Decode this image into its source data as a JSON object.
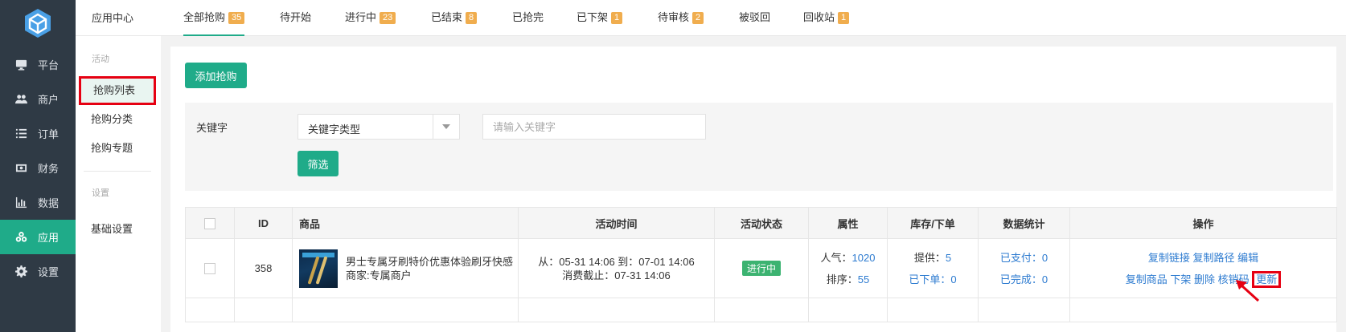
{
  "sidebar": {
    "items": [
      {
        "label": "平台",
        "icon": "monitor-icon"
      },
      {
        "label": "商户",
        "icon": "users-icon"
      },
      {
        "label": "订单",
        "icon": "list-icon"
      },
      {
        "label": "财务",
        "icon": "money-icon"
      },
      {
        "label": "数据",
        "icon": "bar-chart-icon"
      },
      {
        "label": "应用",
        "icon": "apps-icon"
      },
      {
        "label": "设置",
        "icon": "gear-icon"
      }
    ],
    "active": "应用"
  },
  "subnav": {
    "title": "应用中心",
    "group1": "活动",
    "items1": [
      "抢购列表",
      "抢购分类",
      "抢购专题"
    ],
    "group2": "设置",
    "items2": [
      "基础设置"
    ]
  },
  "tabs": [
    {
      "label": "全部抢购",
      "badge": "35"
    },
    {
      "label": "待开始",
      "badge": ""
    },
    {
      "label": "进行中",
      "badge": "23"
    },
    {
      "label": "已结束",
      "badge": "8"
    },
    {
      "label": "已抢完",
      "badge": ""
    },
    {
      "label": "已下架",
      "badge": "1"
    },
    {
      "label": "待审核",
      "badge": "2"
    },
    {
      "label": "被驳回",
      "badge": ""
    },
    {
      "label": "回收站",
      "badge": "1"
    }
  ],
  "toolbar": {
    "add_label": "添加抢购"
  },
  "filter": {
    "keyword_label": "关键字",
    "select_value": "关键字类型",
    "input_placeholder": "请输入关键字",
    "submit_label": "筛选"
  },
  "table": {
    "headers": [
      "ID",
      "商品",
      "活动时间",
      "活动状态",
      "属性",
      "库存/下单",
      "数据统计",
      "操作"
    ],
    "row": {
      "id": "358",
      "product_line1": "男士专属牙刷特价优惠体验刷牙快感",
      "product_line2": "商家:专属商户",
      "time_line1": "从：05-31 14:06 到：07-01 14:06",
      "time_line2": "消费截止：07-31 14:06",
      "status": "进行中",
      "popularity_label": "人气：",
      "popularity_value": "1020",
      "sort_label": "排序：",
      "sort_value": "55",
      "supply_label": "提供：",
      "supply_value": "5",
      "ordered_label": "已下单：",
      "ordered_value": "0",
      "paid_label": "已支付：",
      "paid_value": "0",
      "completed_label": "已完成：",
      "completed_value": "0",
      "ops1": [
        "复制链接",
        "复制路径",
        "编辑"
      ],
      "ops2": [
        "复制商品",
        "下架",
        "删除",
        "核销码",
        "更新"
      ]
    }
  },
  "colors": {
    "accent": "#1fab89",
    "badge": "#f0ad4e",
    "highlight": "#e60012",
    "link": "#2d7bd0"
  }
}
